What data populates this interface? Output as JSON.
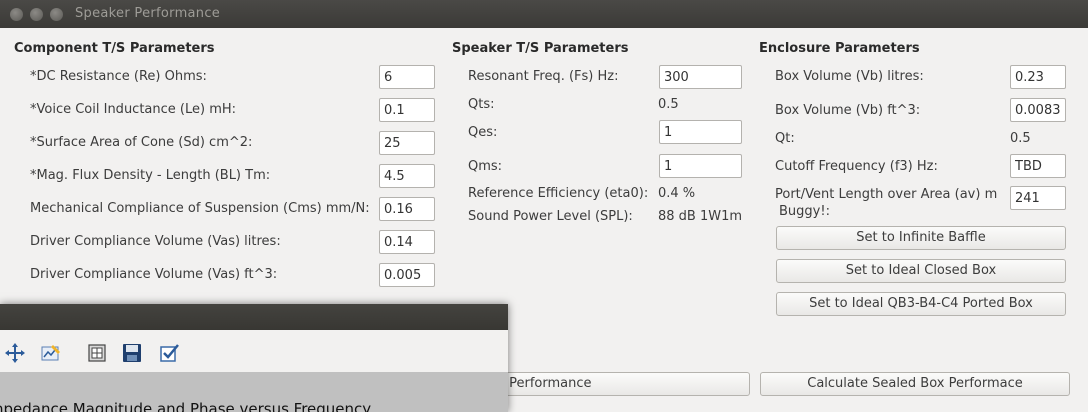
{
  "window": {
    "title": "Speaker Performance"
  },
  "component": {
    "heading": "Component T/S Parameters",
    "rows": [
      {
        "label": "*DC Resistance (Re) Ohms:",
        "value": "6"
      },
      {
        "label": "*Voice Coil Inductance (Le) mH:",
        "value": "0.1"
      },
      {
        "label": "*Surface Area of Cone (Sd) cm^2:",
        "value": "25"
      },
      {
        "label": "*Mag. Flux Density - Length (BL) Tm:",
        "value": "4.5"
      },
      {
        "label": "Mechanical Compliance of Suspension (Cms) mm/N:",
        "value": "0.16"
      },
      {
        "label": "Driver Compliance Volume (Vas) litres:",
        "value": "0.14"
      },
      {
        "label": "Driver Compliance Volume (Vas) ft^3:",
        "value": "0.005"
      }
    ]
  },
  "speaker": {
    "heading": "Speaker T/S Parameters",
    "fs_label": "Resonant Freq. (Fs) Hz:",
    "fs_value": "300",
    "qts_label": "Qts:",
    "qts_value": "0.5",
    "qes_label": "Qes:",
    "qes_value": "1",
    "qms_label": "Qms:",
    "qms_value": "1",
    "eff_label": "Reference Efficiency (eta0):",
    "eff_value": "0.4 %",
    "spl_label": "Sound Power Level (SPL):",
    "spl_value": "88 dB 1W1m"
  },
  "enclosure": {
    "heading": "Enclosure Parameters",
    "vb_l_label": "Box Volume (Vb) litres:",
    "vb_l_value": "0.23",
    "vb_ft_label": "Box Volume (Vb) ft^3:",
    "vb_ft_value": "0.0083",
    "qt_label": "Qt:",
    "qt_value": "0.5",
    "f3_label": "Cutoff Frequency (f3) Hz:",
    "f3_value": "TBD",
    "av_label_line1": "Port/Vent Length over Area (av) m",
    "av_label_line2": "Buggy!:",
    "av_value": "241",
    "btn_infinite": "Set to Infinite Baffle",
    "btn_closed": "Set to Ideal Closed Box",
    "btn_ported": "Set to Ideal QB3-B4-C4 Ported Box"
  },
  "actions": {
    "calc_left_visible": "e Performance",
    "calc_sealed": "Calculate Sealed Box Performace"
  },
  "plot_window": {
    "title_visible": "npedance Magnitude and Phase versus Frequency",
    "icons": [
      "move-icon",
      "edit-axes-icon",
      "configure-icon",
      "save-icon",
      "checkbox-icon"
    ]
  },
  "colors": {
    "titlebar": "#3b3a37",
    "window_bg": "#f2f1f0",
    "plot_bg": "#c0c0c0"
  }
}
